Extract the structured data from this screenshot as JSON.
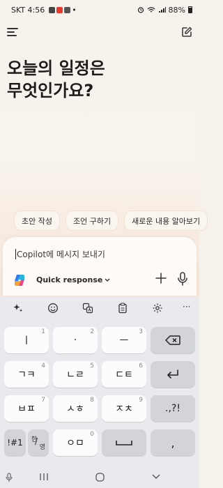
{
  "status": {
    "time": "SKT 4:56",
    "notif_dot": "•",
    "battery": "88%"
  },
  "header": {
    "menu_icon": "hamburger-menu-icon",
    "compose_icon": "new-chat-icon"
  },
  "headline": {
    "line1": "오늘의 일정은",
    "line2": "무엇인가요?"
  },
  "suggestions": [
    "초안 작성",
    "조언 구하기",
    "새로운 내용 알아보기"
  ],
  "composer": {
    "placeholder": "Copilot에 메시지 보내기",
    "mode_label": "Quick response"
  },
  "keyboard": {
    "toolbar": [
      "ai-sparkle-icon",
      "emoji-icon",
      "translate-icon",
      "clipboard-icon",
      "settings-icon",
      "more-icon"
    ],
    "more_label": "···",
    "rows": [
      [
        {
          "label": "ㅣ",
          "num": "1"
        },
        {
          "label": "·",
          "num": "2"
        },
        {
          "label": "ㅡ",
          "num": "3"
        },
        {
          "label": "backspace",
          "num": ""
        }
      ],
      [
        {
          "label": "ㄱㅋ",
          "num": "4"
        },
        {
          "label": "ㄴㄹ",
          "num": "5"
        },
        {
          "label": "ㄷㅌ",
          "num": "6"
        },
        {
          "label": "enter",
          "num": ""
        }
      ],
      [
        {
          "label": "ㅂㅍ",
          "num": "7"
        },
        {
          "label": "ㅅㅎ",
          "num": "8"
        },
        {
          "label": "ㅈㅊ",
          "num": "9"
        },
        {
          "label": ".,?!",
          "num": ""
        }
      ],
      [
        {
          "label": "!#1",
          "num": ""
        },
        {
          "label": "한/영",
          "num": ""
        },
        {
          "label": "ㅇㅁ",
          "num": "0"
        },
        {
          "label": "space",
          "num": ""
        },
        {
          "label": ",",
          "num": ""
        }
      ]
    ],
    "hangul_top": "한",
    "hangul_bottom": "영"
  },
  "navbar": [
    "recent-apps-icon",
    "home-icon",
    "back-icon",
    "keyboard-mic-icon"
  ]
}
